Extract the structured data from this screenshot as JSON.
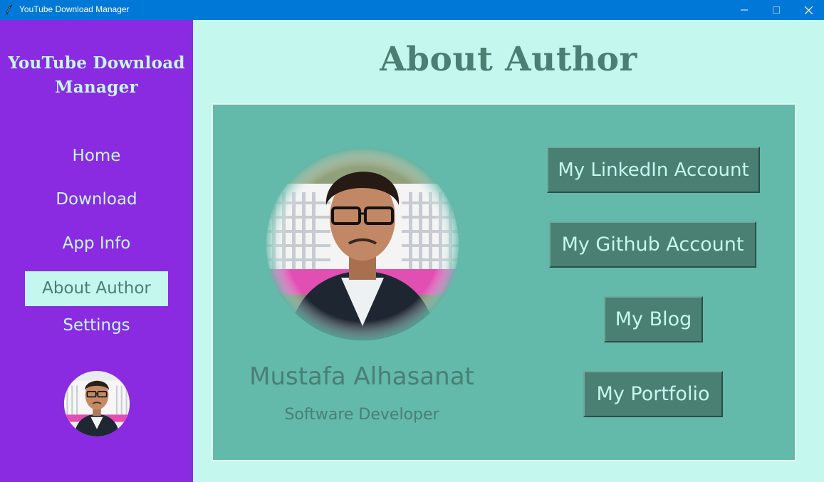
{
  "window": {
    "title": "YouTube Download Manager"
  },
  "sidebar": {
    "app_name_line1": "YouTube Download",
    "app_name_line2": "Manager",
    "items": [
      {
        "label": "Home"
      },
      {
        "label": "Download"
      },
      {
        "label": "App Info"
      },
      {
        "label": "About Author",
        "active": true
      },
      {
        "label": "Settings"
      }
    ]
  },
  "main": {
    "title": "About Author",
    "author": {
      "name": "Mustafa Alhasanat",
      "role": "Software Developer"
    },
    "links": [
      {
        "label": "My LinkedIn Account"
      },
      {
        "label": "My Github Account"
      },
      {
        "label": "My Blog"
      },
      {
        "label": "My Portfolio"
      }
    ]
  },
  "colors": {
    "titlebar": "#0078d7",
    "sidebar": "#8a2be2",
    "background": "#c4f8ee",
    "card": "#63b9aa",
    "accent": "#4a7f74"
  }
}
